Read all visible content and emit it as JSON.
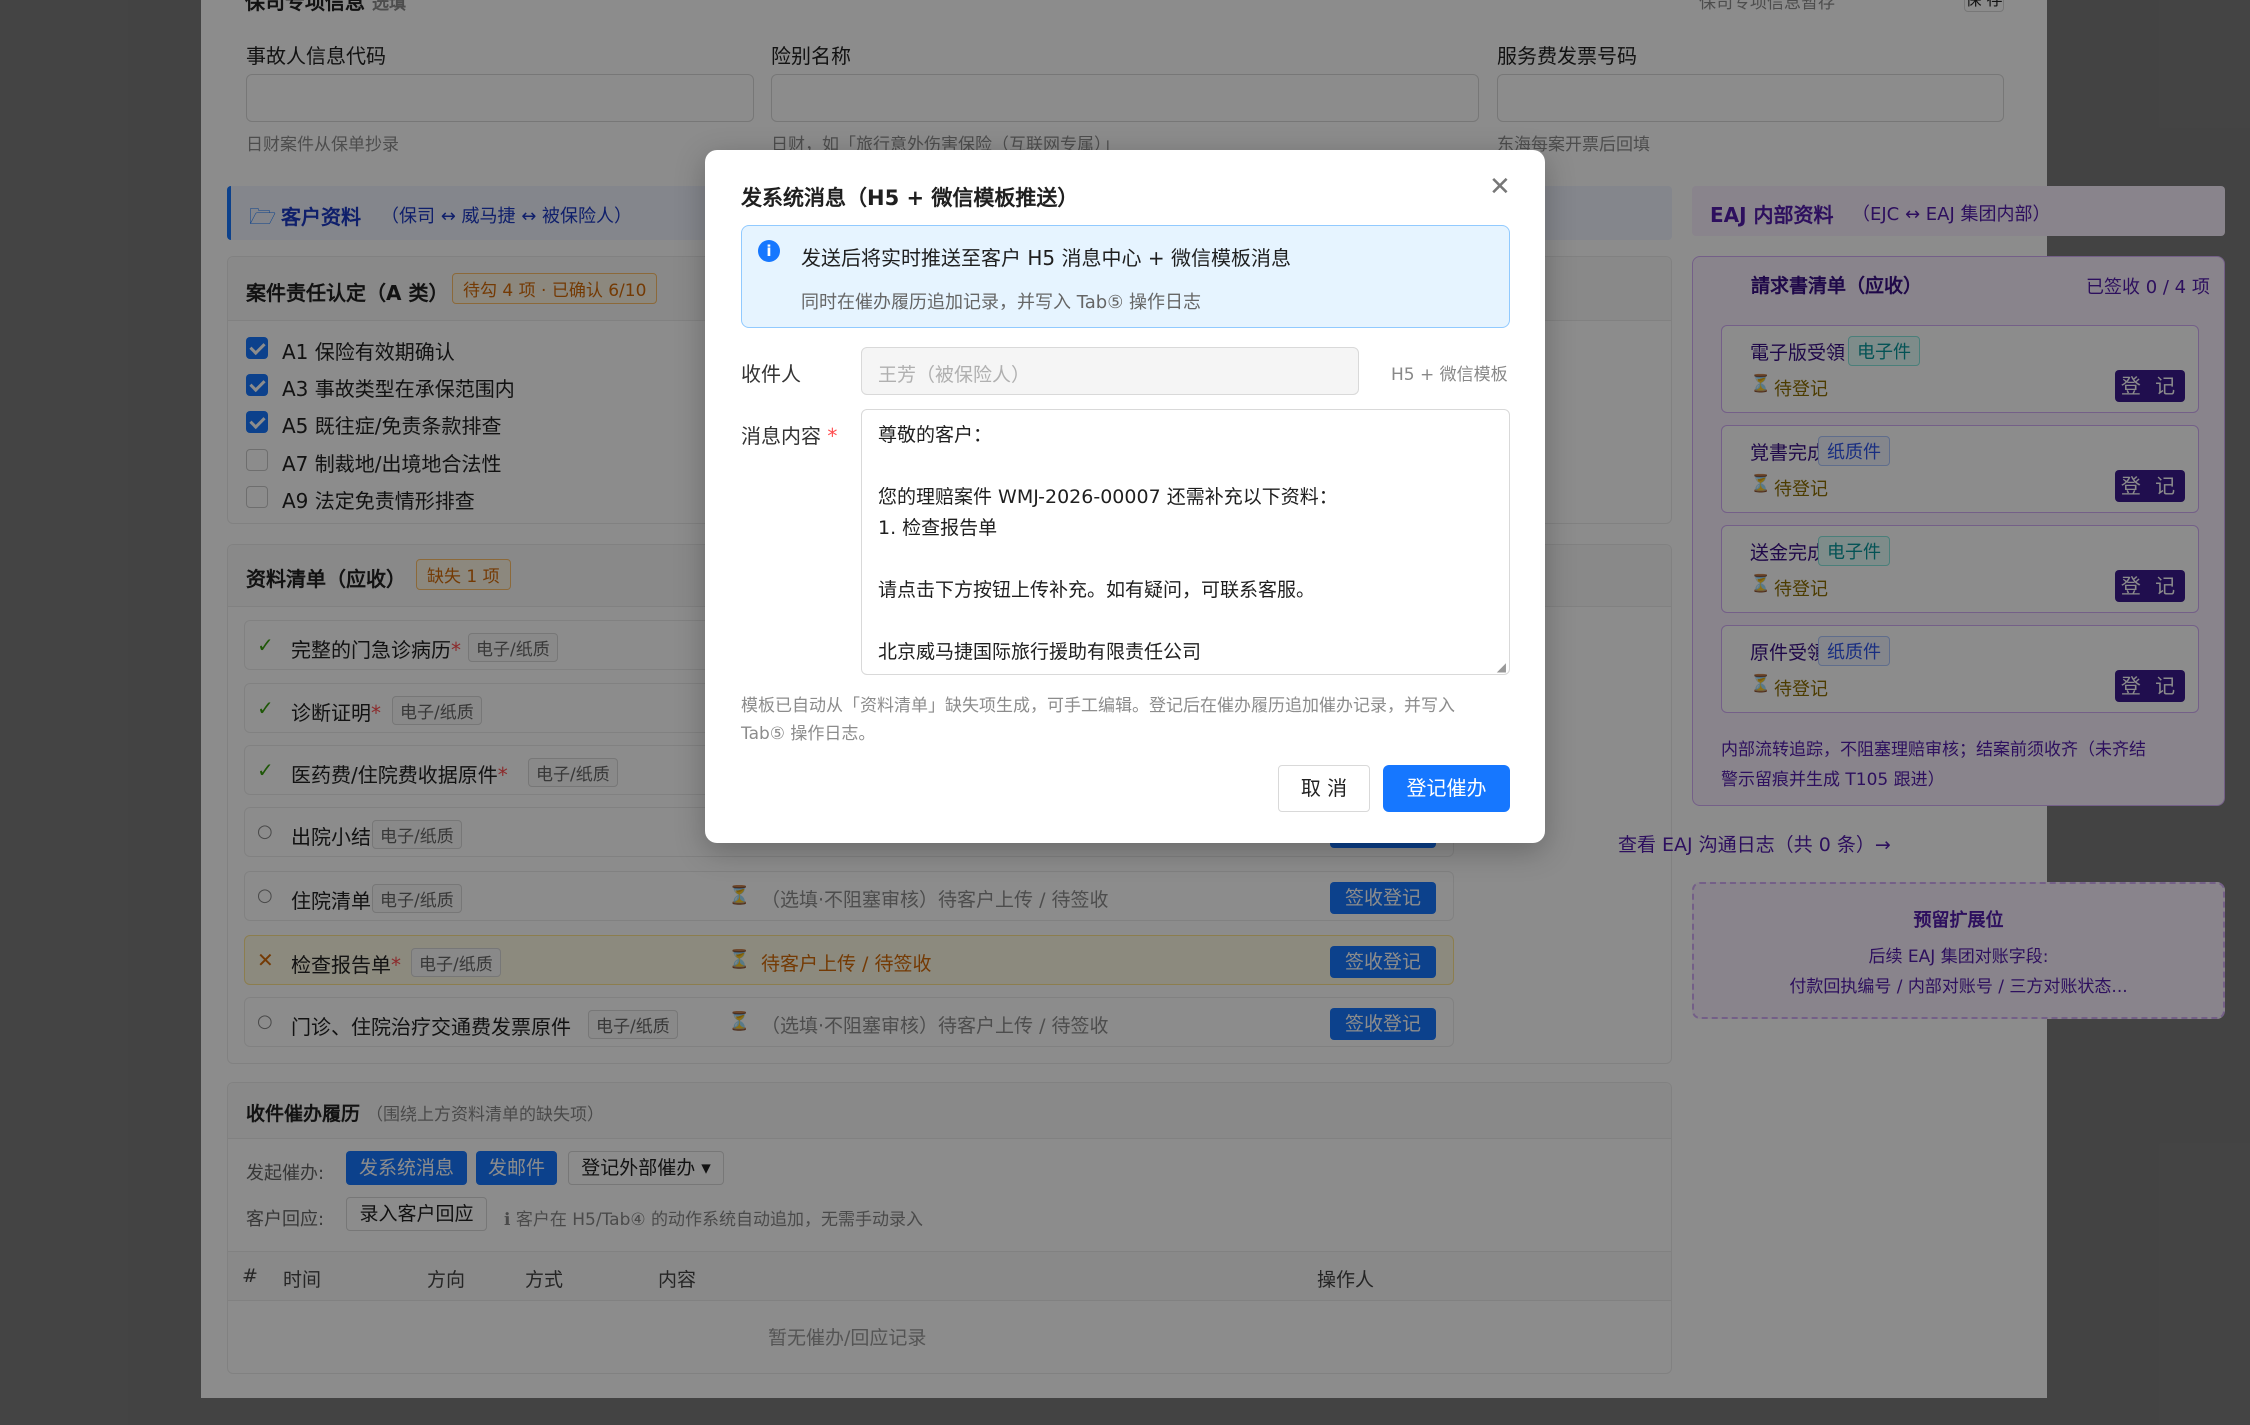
{
  "bg": {
    "top_header_partial": "保司专项信息",
    "top_header_note": "选填",
    "top_right_note": "保司专项信息暂存",
    "top_right_button": "保 存",
    "fields": [
      {
        "label": "事故人信息代码",
        "hint": "日财案件从保单抄录"
      },
      {
        "label": "险别名称",
        "hint": "日财，如「旅行意外伤害保险（互联网专属）」"
      },
      {
        "label": "服务费发票号码",
        "hint": "东海每案开票后回填"
      }
    ],
    "customer_section": {
      "title": "客户资料",
      "subtitle": "（保司 ↔ 威马捷 ↔ 被保险人）"
    },
    "eaj_section": {
      "title": "EAJ 内部资料",
      "subtitle": "（EJC ↔ EAJ 集团内部）"
    },
    "liability": {
      "title": "案件责任认定（A 类）",
      "badge": "待勾 4 项 · 已确认 6/10",
      "items": [
        {
          "label": "A1 保险有效期确认",
          "checked": true
        },
        {
          "label": "A3 事故类型在承保范围内",
          "checked": true
        },
        {
          "label": "A5 既往症/免责条款排查",
          "checked": true
        },
        {
          "label": "A7 制裁地/出境地合法性",
          "checked": false
        },
        {
          "label": "A9 法定免责情形排查",
          "checked": false
        }
      ]
    },
    "docs": {
      "title": "资料清单（应收）",
      "badge": "缺失 1 项",
      "rows": [
        {
          "mark": "✓",
          "name": "完整的门急诊病历",
          "required": true,
          "tag": "电子/纸质",
          "status": "",
          "action": ""
        },
        {
          "mark": "✓",
          "name": "诊断证明",
          "required": true,
          "tag": "电子/纸质",
          "status": "",
          "action": ""
        },
        {
          "mark": "✓",
          "name": "医药费/住院费收据原件",
          "required": true,
          "tag": "电子/纸质",
          "status": "",
          "action": ""
        },
        {
          "mark": "○",
          "name": "出院小结",
          "required": false,
          "tag": "电子/纸质",
          "status": "",
          "action": ""
        },
        {
          "mark": "○",
          "name": "住院清单",
          "required": false,
          "tag": "电子/纸质",
          "status": "（选填·不阻塞审核）待客户上传 / 待签收",
          "action": "签收登记"
        },
        {
          "mark": "✕",
          "name": "检查报告单",
          "required": true,
          "tag": "电子/纸质",
          "status": "待客户上传 / 待签收",
          "action": "签收登记"
        },
        {
          "mark": "○",
          "name": "门诊、住院治疗交通费发票原件",
          "required": false,
          "tag": "电子/纸质",
          "status": "（选填·不阻塞审核）待客户上传 / 待签收",
          "action": "签收登记"
        }
      ]
    },
    "followup": {
      "title": "收件催办履历",
      "subtitle": "（围绕上方资料清单的缺失项）",
      "start_label": "发起催办:",
      "btn_sys": "发系统消息",
      "btn_mail": "发邮件",
      "btn_ext": "登记外部催办 ▾",
      "reply_label": "客户回应:",
      "btn_reply": "录入客户回应",
      "reply_hint": "ℹ 客户在 H5/Tab④ 的动作系统自动追加，无需手动录入",
      "columns": [
        "#",
        "时间",
        "方向",
        "方式",
        "内容",
        "操作人"
      ],
      "empty": "暂无催办/回应记录"
    },
    "request": {
      "title": "請求書清单（应收）",
      "count": "已签收 0 / 4 项",
      "items": [
        {
          "name": "電子版受領",
          "tag": "电子件",
          "tag_kind": "green",
          "status": "待登记",
          "btn": "登 记"
        },
        {
          "name": "覚書完成",
          "tag": "纸质件",
          "tag_kind": "purple",
          "status": "待登记",
          "btn": "登 记"
        },
        {
          "name": "送金完成",
          "tag": "电子件",
          "tag_kind": "green",
          "status": "待登记",
          "btn": "登 记"
        },
        {
          "name": "原件受領",
          "tag": "纸质件",
          "tag_kind": "purple",
          "status": "待登记",
          "btn": "登 记"
        }
      ],
      "note_line1": "内部流转追踪，不阻塞理赔审核；结案前须收齐（未齐结",
      "note_line2": "警示留痕并生成 T105 跟进）"
    },
    "eaj_log_link": "查看 EAJ 沟通日志（共 0 条）→",
    "reserved": {
      "title": "预留扩展位",
      "line1": "后续 EAJ 集团对账字段:",
      "line2": "付款回执编号 / 内部对账号 / 三方对账状态..."
    }
  },
  "modal": {
    "title": "发系统消息（H5 + 微信模板推送）",
    "info_title": "发送后将实时推送至客户 H5 消息中心 + 微信模板消息",
    "info_desc": "同时在催办履历追加记录，并写入 Tab⑤ 操作日志",
    "recipient_label": "收件人",
    "recipient_value": "王芳（被保险人）",
    "recipient_suffix": "H5 + 微信模板",
    "content_label": "消息内容",
    "content_lines": [
      "尊敬的客户：",
      "",
      "您的理赔案件 WMJ-2026-00007 还需补充以下资料：",
      "1. 检查报告单",
      "",
      "请点击下方按钮上传补充。如有疑问，可联系客服。",
      "",
      "北京威马捷国际旅行援助有限责任公司"
    ],
    "helper_line1": "模板已自动从「资料清单」缺失项生成，可手工编辑。登记后在催办履历追加催办记录，并写入",
    "helper_line2": "Tab⑤ 操作日志。",
    "cancel": "取 消",
    "confirm": "登记催办"
  },
  "colors": {
    "primary": "#1677ff",
    "purple_btn": "#3b1a8f",
    "warn": "#d46b08",
    "ok": "#389e0d"
  }
}
